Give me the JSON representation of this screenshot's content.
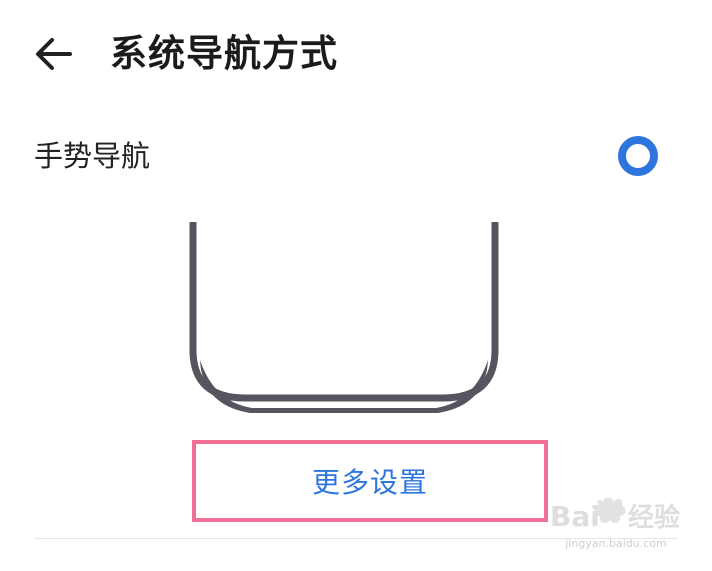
{
  "header": {
    "back_icon": "arrow-left-icon",
    "title": "系统导航方式"
  },
  "navigation_option": {
    "label": "手势导航",
    "selected": true,
    "radio_icon": "radio-selected-icon",
    "accent_color": "#2f75de"
  },
  "illustration": {
    "icon": "phone-gesture-illustration-icon",
    "frame_color": "#55555f"
  },
  "more_settings": {
    "label": "更多设置",
    "highlight_color": "#ef6f95"
  },
  "watermark": {
    "brand": "Baidu经验",
    "domain": "jingyan.baidu.com"
  }
}
